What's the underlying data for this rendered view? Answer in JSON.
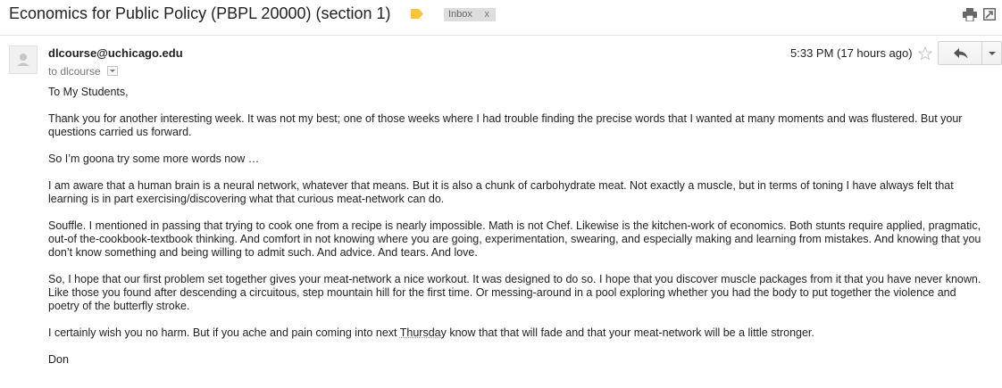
{
  "subject": "Economics for Public Policy (PBPL 20000) (section 1)",
  "label_chip": {
    "text": "Inbox",
    "close": "x"
  },
  "sender": {
    "email": "dlcourse@uchicago.edu"
  },
  "recipient_line": {
    "prefix": "to",
    "name": "dlcourse"
  },
  "timestamp": "5:33 PM (17 hours ago)",
  "colors": {
    "label_tag": "#f9c536",
    "text": "#222222",
    "muted": "#777777"
  },
  "icons": [
    "label-tag-icon",
    "print-icon",
    "new-window-icon",
    "avatar-icon",
    "star-icon",
    "reply-icon",
    "chevron-down-icon"
  ],
  "body": {
    "greeting": "To My Students,",
    "p1": "Thank you for another interesting week.  It was not my best; one of those weeks where I had trouble finding the precise words that I wanted at many moments and was flustered.  But your questions carried us forward.",
    "p2": "So I’m goona try some more words now …",
    "p3": "I am aware that a human brain is a neural network, whatever that means.  But it is also a chunk of carbohydrate meat.  Not exactly a muscle, but in terms of toning I have always felt that learning is in part exercising/discovering what that curious meat-network can do.",
    "p4": "Souffle.  I mentioned in passing that trying to cook one from a recipe is nearly impossible.  Math is not Chef.  Likewise is the kitchen-work of economics.  Both stunts require applied, pragmatic, out-of the-cookbook-textbook thinking.  And comfort in not knowing where you are going, experimentation, swearing, and especially making and learning from mistakes.  And knowing that you don’t know something and being willing to admit such.  And advice.  And tears. And love.",
    "p5": "So, I hope that our first problem set together gives your meat-network a nice workout.  It was designed to do so.  I hope that you discover muscle packages from it that you have never known.  Like those you found after descending a circuitous, step mountain hill for the first time.  Or messing-around in a pool exploring whether you had the body to put together the violence and poetry of the butterfly stroke.",
    "p6_before": "I certainly wish you no harm.  But if you ache and pain coming into next ",
    "p6_word": "Thursday",
    "p6_after": " know that that will fade and that your meat-network will be a little stronger.",
    "signature": "Don"
  }
}
